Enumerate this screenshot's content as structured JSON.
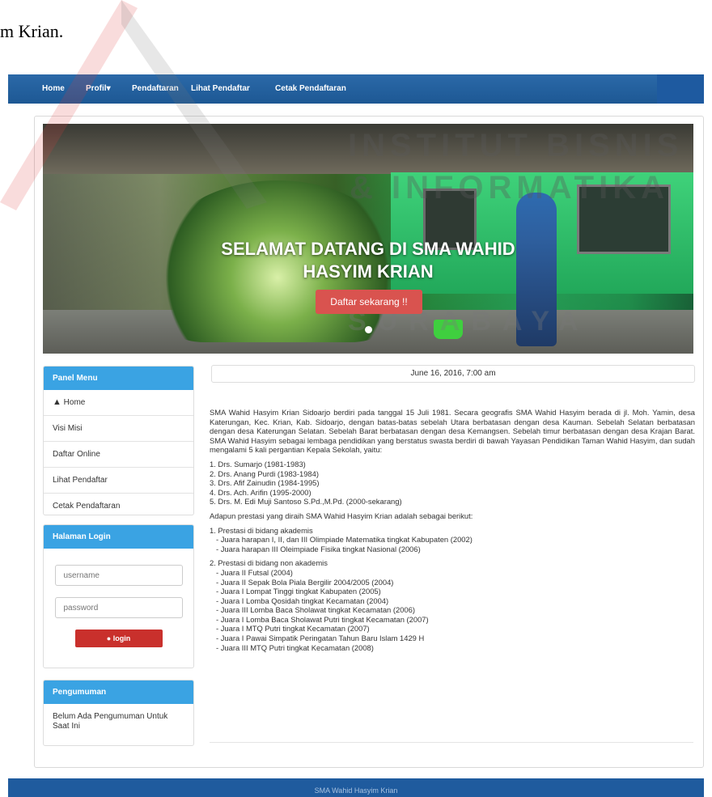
{
  "document_caption": "m Krian.",
  "navbar": {
    "items": [
      "Home",
      "Profil",
      "Pendaftaran",
      "Lihat Pendaftar",
      "Cetak Pendaftaran"
    ],
    "profil_caret": "▾"
  },
  "watermark": {
    "line1": "INSTITUT BISNIS",
    "line2": "& INFORMATIKA",
    "line3": "SURABAYA"
  },
  "hero": {
    "title_line1": "SELAMAT DATANG DI SMA WAHID",
    "title_line2": "HASYIM KRIAN",
    "button_label": "Daftar sekarang !!"
  },
  "panel_menu": {
    "heading": "Panel Menu",
    "items": [
      "Home",
      "Visi Misi",
      "Daftar Online",
      "Lihat Pendaftar",
      "Cetak Pendaftaran"
    ]
  },
  "login": {
    "heading": "Halaman Login",
    "username_placeholder": "username",
    "password_placeholder": "password",
    "button_label": "login"
  },
  "pengumuman": {
    "heading": "Pengumuman",
    "text": "Belum Ada Pengumuman Untuk Saat Ini"
  },
  "date_text": "June 16, 2016, 7:00 am",
  "content": {
    "intro": "SMA Wahid Hasyim Krian Sidoarjo berdiri pada tanggal 15 Juli 1981. Secara geografis SMA Wahid Hasyim berada di jl. Moh. Yamin, desa Katerungan, Kec. Krian, Kab. Sidoarjo, dengan batas-batas sebelah Utara berbatasan dengan desa Kauman. Sebelah Selatan berbatasan dengan desa Katerungan Selatan. Sebelah Barat berbatasan dengan desa Kemangsen. Sebelah timur berbatasan dengan desa Krajan Barat. SMA Wahid Hasyim sebagai lembaga pendidikan yang berstatus swasta berdiri di bawah Yayasan Pendidikan Taman Wahid Hasyim, dan sudah mengalami 5 kali pergantian Kepala Sekolah, yaitu:",
    "heads": [
      "1. Drs. Sumarjo (1981-1983)",
      "2. Drs. Anang Purdi (1983-1984)",
      "3. Drs. Afif Zainudin (1984-1995)",
      "4. Drs. Ach. Arifin (1995-2000)",
      "5. Drs. M. Edi Muji Santoso S.Pd.,M.Pd. (2000-sekarang)"
    ],
    "prestasi_intro": "Adapun prestasi yang diraih SMA Wahid Hasyim Krian adalah sebagai berikut:",
    "akademis_title": "1. Prestasi di bidang akademis",
    "akademis": [
      "- Juara harapan I, II, dan III Olimpiade Matematika tingkat Kabupaten (2002)",
      "- Juara harapan III Oleimpiade Fisika tingkat Nasional (2006)"
    ],
    "non_akademis_title": "2. Prestasi di bidang non akademis",
    "non_akademis": [
      "- Juara II Futsal (2004)",
      "- Juara II Sepak Bola Piala Bergilir 2004/2005 (2004)",
      "- Juara I Lompat Tinggi tingkat Kabupaten (2005)",
      "- Juara I Lomba Qosidah tingkat Kecamatan (2004)",
      "- Juara III Lomba Baca Sholawat tingkat Kecamatan (2006)",
      "- Juara I Lomba Baca Sholawat Putri tingkat Kecamatan (2007)",
      "- Juara I MTQ Putri tingkat Kecamatan (2007)",
      "- Juara I Pawai Simpatik Peringatan Tahun Baru Islam 1429 H",
      "- Juara III MTQ Putri tingkat Kecamatan (2008)"
    ]
  },
  "footer_text": "SMA Wahid Hasyim Krian",
  "colors": {
    "navbar": "#1d5894",
    "panel_heading": "#3aa3e3",
    "hero_button": "#d9534f",
    "login_button": "#c9302c",
    "footer": "#1f5b9e"
  }
}
